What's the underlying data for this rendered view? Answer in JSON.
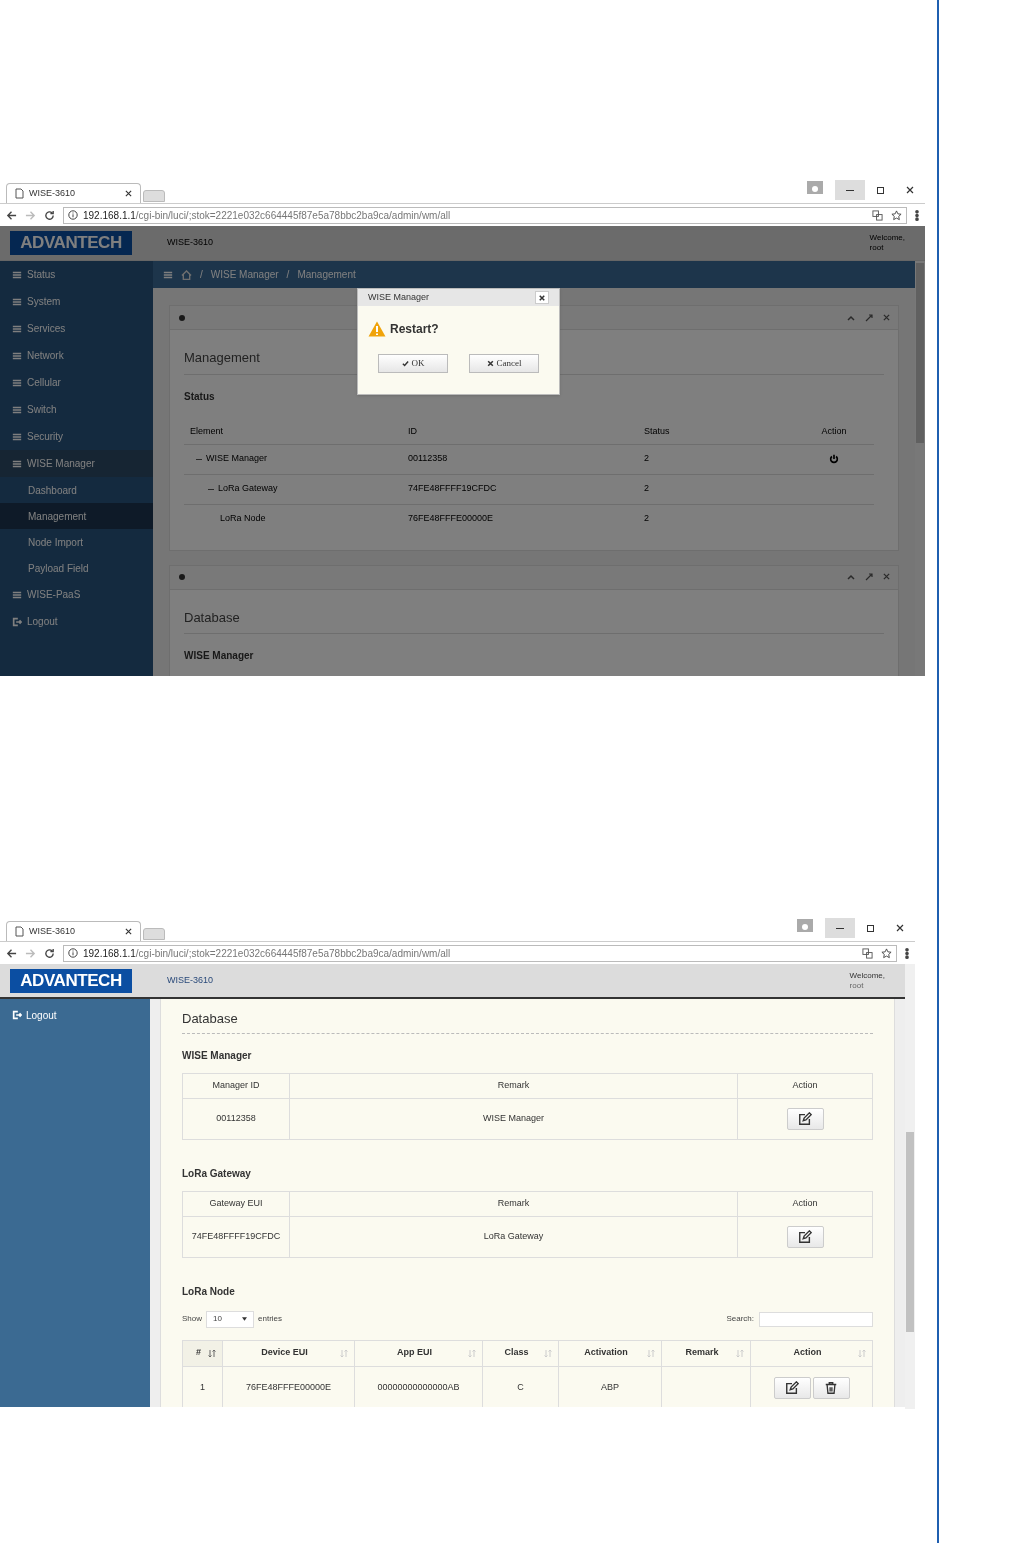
{
  "screenshots": [
    {
      "kind": "dialog_view",
      "browser": {
        "tab_title": "WISE-3610",
        "url_host": "192.168.1.1",
        "url_path": "/cgi-bin/luci/;stok=2221e032c664445f87e5a78bbc2ba9ca/admin/wm/all"
      },
      "header": {
        "logo": "ADVANTECH",
        "device": "WISE-3610",
        "welcome": "Welcome,",
        "user": "root"
      },
      "sidebar": [
        {
          "label": "Status",
          "kind": "menu",
          "expanded": false
        },
        {
          "label": "System",
          "kind": "menu",
          "expanded": false
        },
        {
          "label": "Services",
          "kind": "menu",
          "expanded": false
        },
        {
          "label": "Network",
          "kind": "menu",
          "expanded": false
        },
        {
          "label": "Cellular",
          "kind": "menu",
          "expanded": false
        },
        {
          "label": "Switch",
          "kind": "menu",
          "expanded": false
        },
        {
          "label": "Security",
          "kind": "menu",
          "expanded": false
        },
        {
          "label": "WISE Manager",
          "kind": "menu",
          "expanded": true,
          "children": [
            {
              "label": "Dashboard",
              "selected": false
            },
            {
              "label": "Management",
              "selected": true
            },
            {
              "label": "Node Import",
              "selected": false
            },
            {
              "label": "Payload Field",
              "selected": false
            }
          ]
        },
        {
          "label": "WISE-PaaS",
          "kind": "menu",
          "expanded": false
        },
        {
          "label": "Logout",
          "kind": "logout",
          "expanded": false
        }
      ],
      "breadcrumb": [
        {
          "separator": "/",
          "label": "WISE Manager"
        },
        {
          "separator": "/",
          "label": "Management"
        }
      ],
      "panels": [
        {
          "title": "Management",
          "subtitle": "Status",
          "columns": [
            "Element",
            "ID",
            "Status",
            "Action"
          ],
          "rows": [
            {
              "element": "WISE Manager",
              "id": "00112358",
              "status": "2",
              "kind": "manager",
              "children": [
                {
                  "element": "LoRa Gateway",
                  "id": "74FE48FFFF19CFDC",
                  "status": "2",
                  "kind": "gateway",
                  "children": [
                    {
                      "element": "LoRa Node",
                      "id": "76FE48FFFE00000E",
                      "status": "2",
                      "kind": "node"
                    }
                  ]
                }
              ]
            }
          ]
        },
        {
          "title": "Database",
          "subtitle": "WISE Manager"
        }
      ],
      "dialog": {
        "title": "WISE Manager",
        "message": "Restart?",
        "buttons": [
          {
            "label": "OK",
            "kind": "confirm"
          },
          {
            "label": "Cancel",
            "kind": "cancel"
          }
        ]
      }
    },
    {
      "kind": "database_view",
      "browser": {
        "tab_title": "WISE-3610",
        "url_host": "192.168.1.1",
        "url_path": "/cgi-bin/luci/;stok=2221e032c664445f87e5a78bbc2ba9ca/admin/wm/all"
      },
      "header": {
        "logo": "ADVANTECH",
        "device": "WISE-3610",
        "welcome": "Welcome,",
        "user": "root"
      },
      "sidebar": [
        {
          "label": "Logout",
          "kind": "logout"
        }
      ],
      "panel": {
        "title": "Database",
        "sections": [
          {
            "title": "WISE Manager",
            "kind": "simple",
            "columns": [
              "Manager ID",
              "Remark",
              "Action"
            ],
            "rows": [
              {
                "cells": [
                  "00112358",
                  "WISE Manager"
                ],
                "kind": "editable"
              }
            ]
          },
          {
            "title": "LoRa Gateway",
            "kind": "simple",
            "columns": [
              "Gateway EUI",
              "Remark",
              "Action"
            ],
            "rows": [
              {
                "cells": [
                  "74FE48FFFF19CFDC",
                  "LoRa Gateway"
                ],
                "kind": "editable"
              }
            ]
          },
          {
            "title": "LoRa Node",
            "kind": "datatable",
            "show_label": "Show",
            "length": "10",
            "entries_label": "entries",
            "search_label": "Search:",
            "columns": [
              {
                "label": "#",
                "sorted": true
              },
              {
                "label": "Device EUI",
                "sorted": false
              },
              {
                "label": "App EUI",
                "sorted": false
              },
              {
                "label": "Class",
                "sorted": false
              },
              {
                "label": "Activation",
                "sorted": false
              },
              {
                "label": "Remark",
                "sorted": false
              },
              {
                "label": "Action",
                "sorted": false
              }
            ],
            "rows": [
              {
                "cells": [
                  "1",
                  "76FE48FFFE00000E",
                  "00000000000000AB",
                  "C",
                  "ABP"
                ],
                "kind": "removable"
              }
            ]
          }
        ]
      }
    }
  ]
}
